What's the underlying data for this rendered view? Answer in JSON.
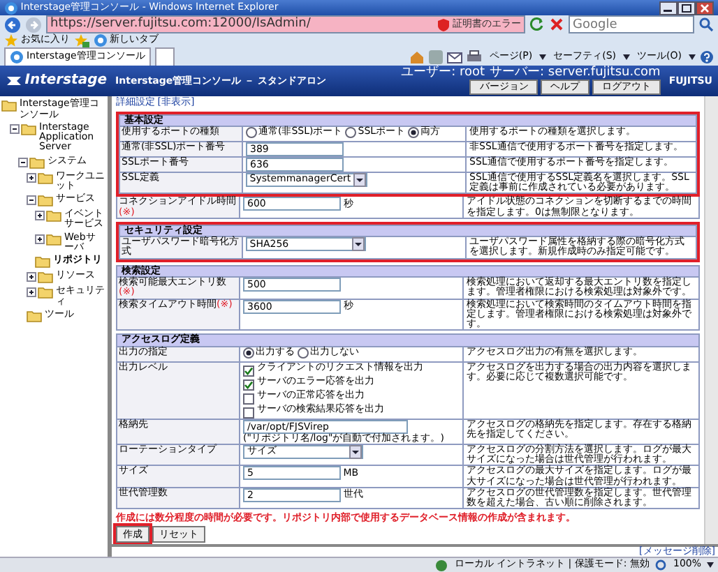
{
  "window": {
    "title": "Interstage管理コンソール - Windows Internet Explorer"
  },
  "browser": {
    "address": "https://server.fujitsu.com:12000/IsAdmin/",
    "cert_error": "証明書のエラー",
    "search_placeholder": "Google",
    "favorites": "お気に入り",
    "new_tab": "新しいタブ",
    "tab": "Interstage管理コンソール",
    "commands": [
      "ページ(P)",
      "セーフティ(S)",
      "ツール(O)"
    ]
  },
  "app_header": {
    "logo": "Interstage",
    "title": "Interstage管理コンソール － スタンドアロン",
    "user": "ユーザー: root",
    "server": "サーバー: server.fujitsu.com",
    "buttons": [
      "バージョン",
      "ヘルプ",
      "ログアウト"
    ],
    "brand": "FUJITSU"
  },
  "tree": [
    {
      "label": "Interstage管理コンソール",
      "children": [
        {
          "label": "Interstage Application Server",
          "expanded": true,
          "children": [
            {
              "label": "システム",
              "expanded": true,
              "children": [
                {
                  "label": "ワークユニット",
                  "expanded": false
                },
                {
                  "label": "サービス",
                  "expanded": true,
                  "children": [
                    {
                      "label": "イベントサービス",
                      "expanded": false
                    },
                    {
                      "label": "Webサーバ",
                      "expanded": false
                    },
                    {
                      "label": "リポジトリ",
                      "selected": true
                    }
                  ]
                },
                {
                  "label": "リソース",
                  "expanded": false
                },
                {
                  "label": "セキュリティ",
                  "expanded": false
                },
                {
                  "label": "ツール",
                  "selected": false
                }
              ]
            }
          ]
        }
      ]
    }
  ],
  "detail": {
    "label": "詳細設定",
    "toggle": "[非表示]"
  },
  "sections": [
    {
      "title": "基本設定",
      "highlighted": true,
      "rows": [
        {
          "label": "使用するポートの種類",
          "highlighted": true,
          "kind": "radio",
          "options": [
            {
              "label": "通常(非SSL)ポート",
              "selected": false
            },
            {
              "label": "SSLポート",
              "selected": false
            },
            {
              "label": "両方",
              "selected": true
            }
          ],
          "description": "使用するポートの種類を選択します。"
        },
        {
          "label": "通常(非SSL)ポート番号",
          "highlighted": true,
          "kind": "text",
          "value": "389",
          "description": "非SSL通信で使用するポート番号を指定します。"
        },
        {
          "label": "SSLポート番号",
          "highlighted": true,
          "kind": "text",
          "value": "636",
          "description": "SSL通信で使用するポート番号を指定します。"
        },
        {
          "label": "SSL定義",
          "highlighted": true,
          "kind": "select",
          "value": "SystemmanagerCert",
          "description": "SSL通信で使用するSSL定義名を選択します。SSL定義は事前に作成されている必要があります。"
        },
        {
          "label": "コネクションアイドル時間",
          "required_mark": "(※)",
          "highlighted": false,
          "kind": "text",
          "value": "600",
          "unit": "秒",
          "description": "アイドル状態のコネクションを切断するまでの時間を指定します。0は無制限となります。"
        }
      ]
    },
    {
      "title": "セキュリティ設定",
      "highlighted": true,
      "rows": [
        {
          "label": "ユーザパスワード暗号化方式",
          "highlighted": true,
          "kind": "select",
          "value": "SHA256",
          "description": "ユーザパスワード属性を格納する際の暗号化方式を選択します。新規作成時のみ指定可能です。"
        }
      ]
    },
    {
      "title": "検索設定",
      "highlighted": false,
      "rows": [
        {
          "label": "検索可能最大エントリ数",
          "required_mark": "(※)",
          "highlighted": false,
          "kind": "text",
          "value": "500",
          "description": "検索処理において返却する最大エントリ数を指定します。管理者権限における検索処理は対象外です。"
        },
        {
          "label": "検索タイムアウト時間",
          "required_mark": "(※)",
          "highlighted": false,
          "kind": "text",
          "value": "3600",
          "unit": "秒",
          "description": "検索処理において検索時間のタイムアウト時間を指定します。管理者権限における検索処理は対象外です。"
        }
      ]
    },
    {
      "title": "アクセスログ定義",
      "highlighted": false,
      "rows": [
        {
          "label": "出力の指定",
          "highlighted": false,
          "kind": "radio",
          "options": [
            {
              "label": "出力する",
              "selected": true
            },
            {
              "label": "出力しない",
              "selected": false
            }
          ],
          "description": "アクセスログ出力の有無を選択します。"
        },
        {
          "label": "出力レベル",
          "highlighted": false,
          "kind": "checks",
          "options": [
            {
              "label": "クライアントのリクエスト情報を出力",
              "checked": true
            },
            {
              "label": "サーバのエラー応答を出力",
              "checked": true
            },
            {
              "label": "サーバの正常応答を出力",
              "checked": false
            },
            {
              "label": "サーバの検索結果応答を出力",
              "checked": false
            }
          ],
          "description": "アクセスログを出力する場合の出力内容を選択します。必要に応じて複数選択可能です。"
        },
        {
          "label": "格納先",
          "highlighted": false,
          "kind": "path",
          "value": "/var/opt/FJSVirep",
          "note": "(\"リポジトリ名/log\"が自動で付加されます。)",
          "description": "アクセスログの格納先を指定します。存在する格納先を指定してください。"
        },
        {
          "label": "ローテーションタイプ",
          "highlighted": false,
          "kind": "select",
          "value": "サイズ",
          "description": "アクセスログの分割方法を選択します。ログが最大サイズになった場合は世代管理が行われます。"
        },
        {
          "label": "サイズ",
          "highlighted": false,
          "kind": "text",
          "value": "5",
          "unit": "MB",
          "description": "アクセスログの最大サイズを指定します。ログが最大サイズになった場合は世代管理が行われます。"
        },
        {
          "label": "世代管理数",
          "highlighted": false,
          "kind": "text",
          "value": "2",
          "unit": "世代",
          "description": "アクセスログの世代管理数を指定します。世代管理数を超えた場合、古い順に削除されます。"
        }
      ]
    }
  ],
  "notice": "作成には数分程度の時間が必要です。リポジトリ内部で使用するデータベース情報の作成が含まれます。",
  "buttons": [
    {
      "label": "作成",
      "highlighted": true
    },
    {
      "label": "リセット",
      "highlighted": false
    }
  ],
  "message_link": "[メッセージ削除]",
  "status_bar": {
    "zone": "ローカル イントラネット | 保護モード: 無効",
    "zoom": "100%"
  }
}
